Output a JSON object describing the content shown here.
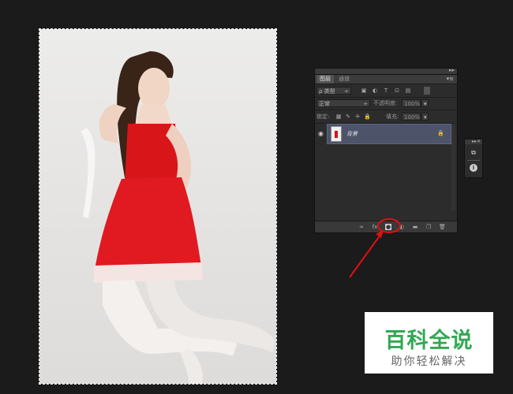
{
  "layers_panel": {
    "tabs": [
      "图层",
      "通道"
    ],
    "filter_kind": "类型",
    "blend_mode": "正常",
    "opacity_label": "不透明度:",
    "opacity_value": "100%",
    "lock_label": "锁定:",
    "fill_label": "填充:",
    "fill_value": "100%",
    "layers": [
      {
        "name": "背景",
        "locked": true,
        "visible": true
      }
    ]
  },
  "watermark": {
    "title": "百科全说",
    "subtitle": "助你轻松解决"
  },
  "colors": {
    "highlight": "#e01010",
    "layer_selected": "#4d546a",
    "brand_green": "#32a852"
  }
}
